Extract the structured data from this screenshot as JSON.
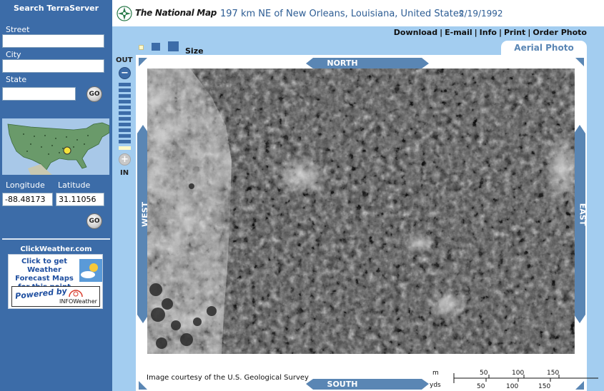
{
  "sidebar": {
    "title": "Search TerraServer",
    "street_label": "Street",
    "street_value": "",
    "city_label": "City",
    "city_value": "",
    "state_label": "State",
    "state_value": "",
    "go_label": "GO",
    "longitude_label": "Longitude",
    "latitude_label": "Latitude",
    "longitude_value": "-88.48173",
    "latitude_value": "31.11056",
    "clickweather_title": "ClickWeather.com",
    "clickweather_text": "Click to get Weather Forecast Maps for this point",
    "powered_by": "Powered by",
    "infoweather": "INFOWeather"
  },
  "header": {
    "logo_text": "The National Map",
    "location": "197 km NE of New Orleans, Louisiana, United States",
    "date": "2/19/1992"
  },
  "toolbar": {
    "links": [
      "Download",
      "E-mail",
      "Info",
      "Print",
      "Order Photo"
    ],
    "size_label": "Size",
    "tab_label": "Aerial Photo"
  },
  "map": {
    "zoom_out_label": "OUT",
    "zoom_in_label": "IN",
    "compass": {
      "north": "NORTH",
      "south": "SOUTH",
      "east": "EAST",
      "west": "WEST"
    },
    "credit": "Image courtesy of the U.S. Geological Survey",
    "scale": {
      "m_label": "m",
      "yds_label": "yds",
      "m_ticks": [
        "50",
        "100",
        "150"
      ],
      "yds_ticks": [
        "50",
        "100",
        "150"
      ]
    }
  },
  "colors": {
    "sidebar_bg": "#3c6ca8",
    "panel_bg": "#a3cdf0",
    "compass_blue": "#5a86b4",
    "title_blue": "#2d5d94"
  }
}
